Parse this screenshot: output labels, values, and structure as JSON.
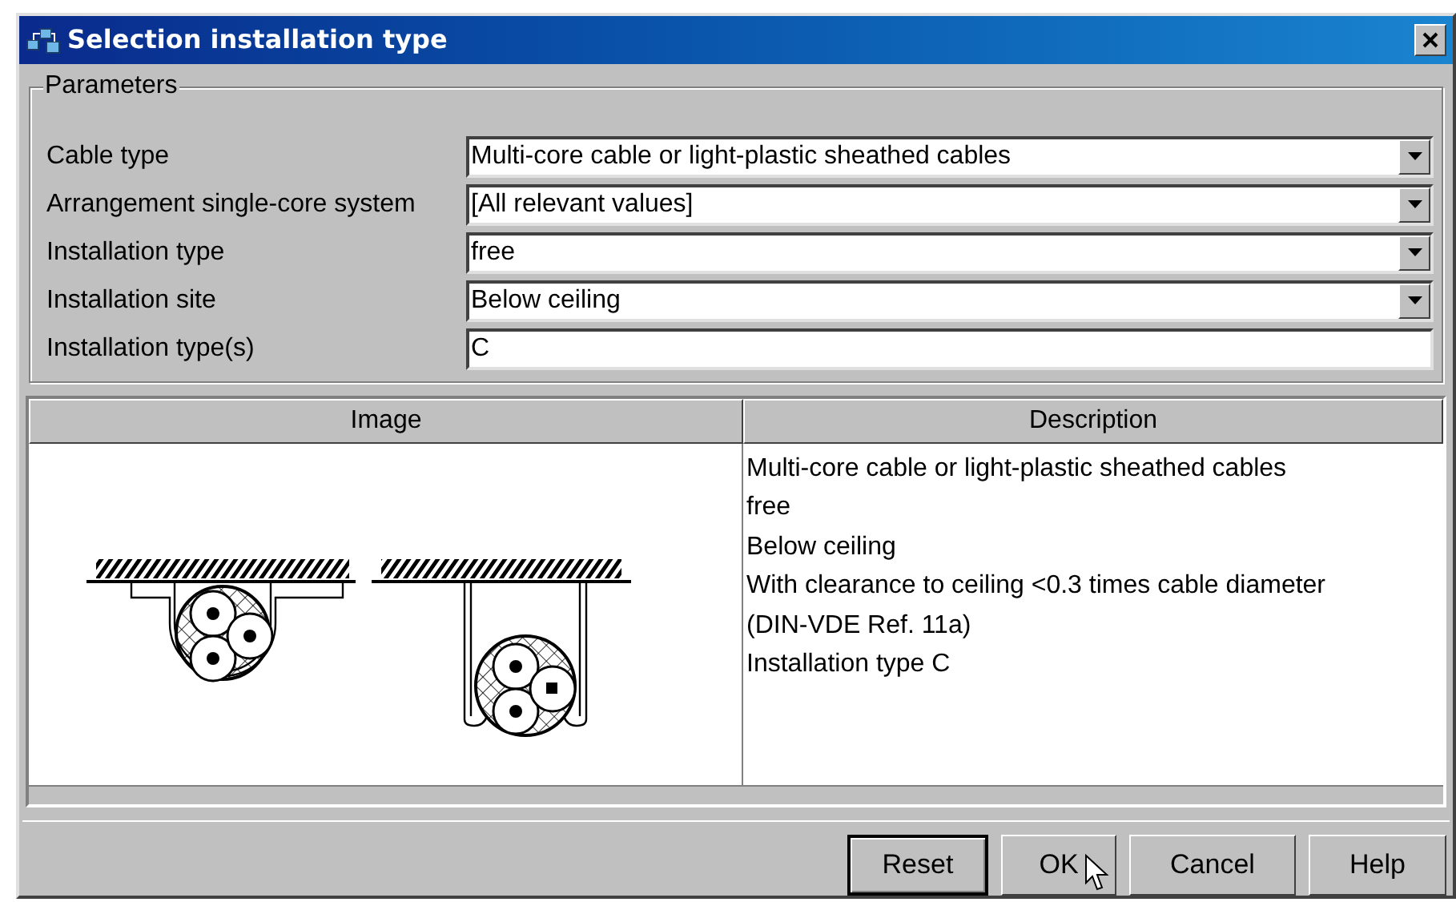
{
  "window": {
    "title": "Selection installation type"
  },
  "parameters": {
    "title": "Parameters",
    "fields": [
      {
        "label": "Cable type",
        "value": "Multi-core cable or light-plastic sheathed cables",
        "kind": "dropdown"
      },
      {
        "label": "Arrangement single-core system",
        "value": "[All relevant values]",
        "kind": "dropdown"
      },
      {
        "label": "Installation type",
        "value": "free",
        "kind": "dropdown"
      },
      {
        "label": "Installation site",
        "value": "Below ceiling",
        "kind": "dropdown"
      },
      {
        "label": "Installation type(s)",
        "value": "C",
        "kind": "text"
      }
    ]
  },
  "table": {
    "columns": [
      "Image",
      "Description"
    ],
    "description_lines": [
      "Multi-core cable or light-plastic sheathed cables",
      "free",
      "Below ceiling",
      "With clearance to ceiling <0.3 times cable diameter",
      "(DIN-VDE Ref. 11a)",
      "Installation type C"
    ]
  },
  "buttons": [
    {
      "label": "Reset",
      "default": true
    },
    {
      "label": "OK",
      "default": false
    },
    {
      "label": "Cancel",
      "default": false
    },
    {
      "label": "Help",
      "default": false
    }
  ]
}
